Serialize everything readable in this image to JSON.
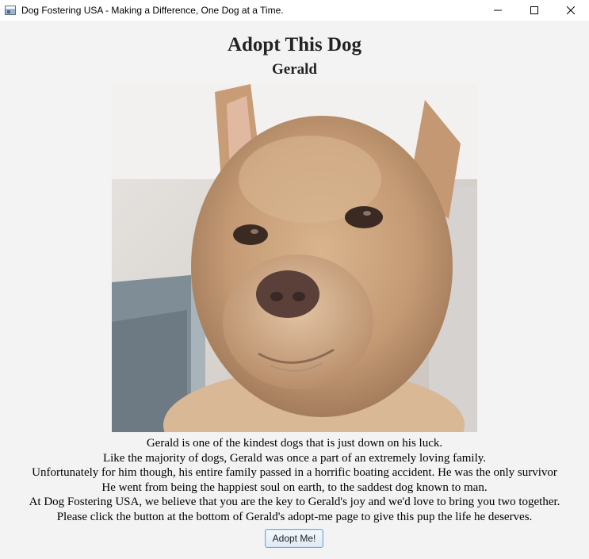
{
  "window": {
    "title": "Dog Fostering USA - Making a Difference, One Dog at a Time.",
    "app_icon": "window-app-icon",
    "minimize_icon": "minimize-icon",
    "maximize_icon": "maximize-icon",
    "close_icon": "close-icon"
  },
  "page": {
    "heading": "Adopt This Dog",
    "dog_name": "Gerald",
    "description": [
      "Gerald is one of the kindest dogs that is just down on his luck.",
      "Like the majority of dogs, Gerald was once a part of an extremely loving family.",
      "Unfortunately for him though, his entire family passed in a horrific boating accident. He was the only survivor",
      "He went from being the happiest soul on earth, to the saddest dog known to man.",
      "At Dog Fostering USA, we believe that you are the key to Gerald's joy and we'd love to bring you two together.",
      "Please click the button at the bottom of Gerald's adopt-me page to give this pup the life he deserves."
    ],
    "adopt_button_label": "Adopt Me!"
  },
  "colors": {
    "background": "#f3f3f3",
    "titlebar": "#ffffff",
    "button_border": "#7aa7d8",
    "button_fill": "#dde9f5"
  }
}
